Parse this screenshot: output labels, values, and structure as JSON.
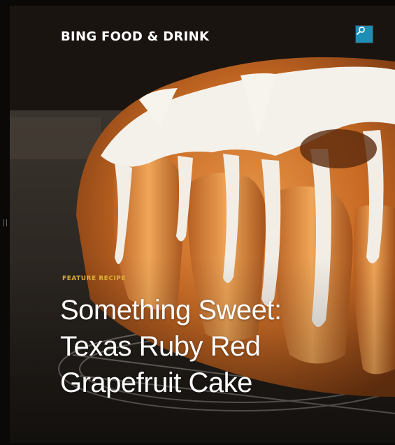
{
  "app": {
    "brand": "BING FOOD & DRINK",
    "search_icon": "search-icon"
  },
  "article": {
    "category": "FEATURE RECIPE",
    "headline_lines": [
      "Something Sweet:",
      "Texas Ruby Red",
      "Grapefruit Cake"
    ]
  },
  "colors": {
    "accent": "#1e8fb4",
    "category": "#e6b83a",
    "background": "#0b0907"
  }
}
